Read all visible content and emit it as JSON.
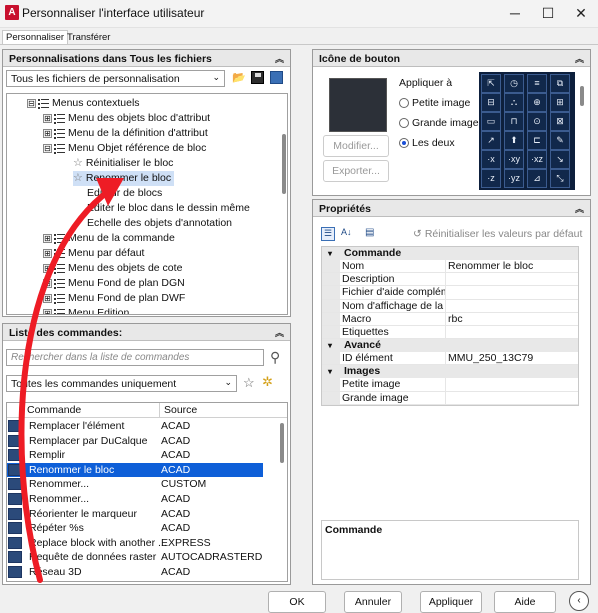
{
  "window": {
    "title": "Personnaliser l'interface utilisateur",
    "app_icon": "A"
  },
  "tabs": [
    {
      "label": "Personnaliser"
    },
    {
      "label": "Transférer"
    }
  ],
  "left_top": {
    "header": "Personnalisations dans Tous les fichiers",
    "combo": "Tous les fichiers de personnalisation",
    "tree": [
      {
        "label": "Menus contextuels",
        "exp": "⊟"
      },
      {
        "label": "Menu des objets bloc d'attribut",
        "exp": "⊞"
      },
      {
        "label": "Menu de la définition d'attribut",
        "exp": "⊞"
      },
      {
        "label": "Menu Objet référence de bloc",
        "exp": "⊟"
      },
      {
        "label": "Réinitialiser le bloc"
      },
      {
        "label": "Renommer le bloc"
      },
      {
        "label": "Editeur de blocs"
      },
      {
        "label": "Editer le bloc dans le dessin même"
      },
      {
        "label": "Echelle des objets d'annotation"
      },
      {
        "label": "Menu de la commande",
        "exp": "⊞"
      },
      {
        "label": "Menu par défaut",
        "exp": "⊞"
      },
      {
        "label": "Menu des objets de cote",
        "exp": "⊞"
      },
      {
        "label": "Menu Fond de plan DGN",
        "exp": "⊞"
      },
      {
        "label": "Menu Fond de plan DWF",
        "exp": "⊞"
      },
      {
        "label": "Menu Edition",
        "exp": "⊞"
      }
    ]
  },
  "commands": {
    "header": "Liste des commandes:",
    "search_placeholder": "Rechercher dans la liste de commandes",
    "filter": "Toutes les commandes uniquement",
    "col_command": "Commande",
    "col_source": "Source",
    "rows": [
      {
        "name": "Remplacer l'élément",
        "source": "ACAD"
      },
      {
        "name": "Remplacer par DuCalque",
        "source": "ACAD"
      },
      {
        "name": "Remplir",
        "source": "ACAD"
      },
      {
        "name": "Renommer le bloc",
        "source": "ACAD",
        "selected": true
      },
      {
        "name": "Renommer...",
        "source": "CUSTOM"
      },
      {
        "name": "Renommer...",
        "source": "ACAD"
      },
      {
        "name": "Réorienter le marqueur",
        "source": "ACAD"
      },
      {
        "name": "Répéter %s",
        "source": "ACAD"
      },
      {
        "name": "Replace block with another ...",
        "source": "EXPRESS"
      },
      {
        "name": "Requête de données raster",
        "source": "AUTOCADRASTERD"
      },
      {
        "name": "Réseau 3D",
        "source": "ACAD"
      }
    ]
  },
  "button_image": {
    "header": "Icône de bouton",
    "apply_label": "Appliquer à",
    "small": "Petite image",
    "large": "Grande image",
    "both": "Les deux",
    "modify": "Modifier...",
    "export": "Exporter...",
    "icons": [
      "⇱",
      "◷",
      "≡",
      "⧉",
      "⊟",
      "⛬",
      "⊕",
      "⊞",
      "▭",
      "⊓",
      "⊙",
      "⊠",
      "↗",
      "⬆",
      "⊏",
      "✎",
      "·x",
      "·xy",
      "·xz",
      "↘",
      "·z",
      "·yz",
      "⊿",
      "⤡"
    ]
  },
  "properties": {
    "header": "Propriétés",
    "reset_label": "Réinitialiser les valeurs par défaut",
    "sections": [
      {
        "name": "Commande",
        "rows": [
          {
            "k": "Nom",
            "v": "Renommer le bloc"
          },
          {
            "k": "Description",
            "v": ""
          },
          {
            "k": "Fichier d'aide compléme",
            "v": ""
          },
          {
            "k": "Nom d'affichage de la co",
            "v": ""
          },
          {
            "k": "Macro",
            "v": "rbc"
          },
          {
            "k": "Etiquettes",
            "v": ""
          }
        ]
      },
      {
        "name": "Avancé",
        "rows": [
          {
            "k": "ID élément",
            "v": "MMU_250_13C79"
          }
        ]
      },
      {
        "name": "Images",
        "rows": [
          {
            "k": "Petite image",
            "v": ""
          },
          {
            "k": "Grande image",
            "v": ""
          }
        ]
      }
    ],
    "description_title": "Commande"
  },
  "footer": {
    "ok": "OK",
    "cancel": "Annuler",
    "apply": "Appliquer",
    "help": "Aide"
  }
}
